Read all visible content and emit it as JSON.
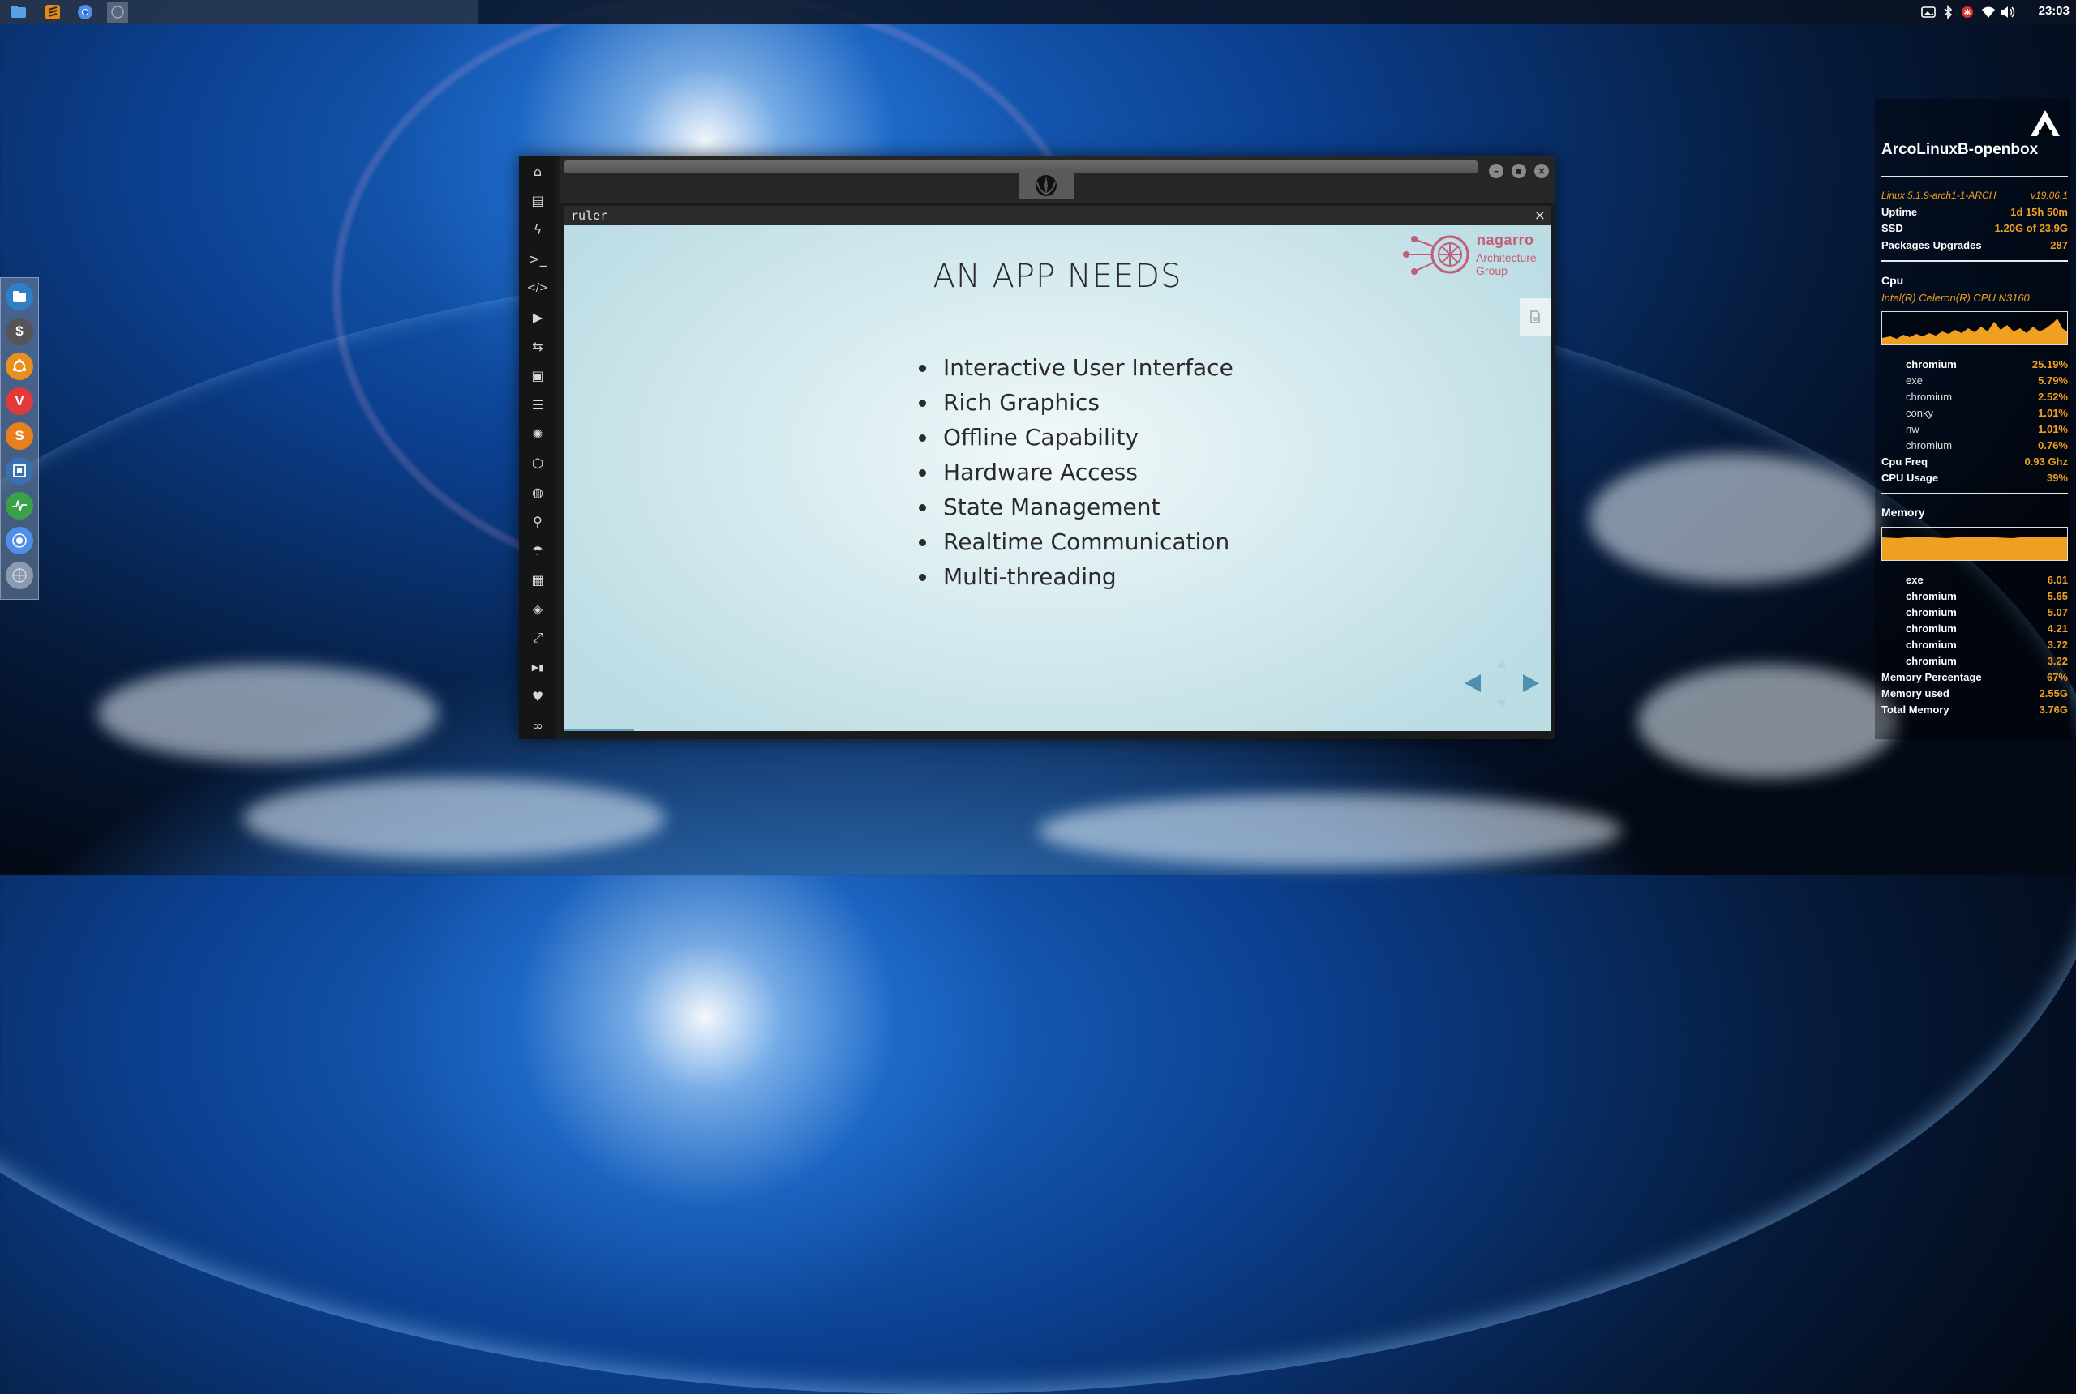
{
  "top_panel": {
    "clock": "23:03",
    "launchers": [
      "file-manager-icon",
      "sublime-text-icon",
      "chromium-icon",
      "workspace-icon"
    ],
    "tray": [
      "photo-icon",
      "bluetooth-icon",
      "network-alert-icon",
      "wifi-icon",
      "volume-icon"
    ]
  },
  "dock": {
    "items": [
      "files",
      "terminal",
      "ubuntu",
      "vivaldi",
      "sublime",
      "screenshot",
      "system-monitor",
      "chromium",
      "network"
    ]
  },
  "app": {
    "url_text": "ruler",
    "url_close": "×",
    "sidebar_icons": [
      "home",
      "document",
      "lightning",
      "terminal",
      "code",
      "play",
      "translate",
      "image",
      "news",
      "aperture",
      "hexagon",
      "globe",
      "search",
      "umbrella",
      "contact",
      "diamond-code",
      "expand",
      "youtube",
      "heart",
      "infinity"
    ]
  },
  "slide": {
    "title": "AN APP NEEDS",
    "bullets": [
      "Interactive User Interface",
      "Rich Graphics",
      "Offline Capability",
      "Hardware Access",
      "State Management",
      "Realtime Communication",
      "Multi-threading"
    ],
    "logo_name": "nagarro",
    "logo_line1": "Architecture",
    "logo_line2": "Group"
  },
  "conky": {
    "hostname": "ArcoLinuxB-openbox",
    "kernel": "Linux 5.1.9-arch1-1-ARCH",
    "version": "v19.06.1",
    "uptime_label": "Uptime",
    "uptime_value": "1d 15h 50m",
    "ssd_label": "SSD",
    "ssd_value": "1.20G of 23.9G",
    "packages_label": "Packages Upgrades",
    "packages_value": "287",
    "cpu_label": "Cpu",
    "cpu_name": "Intel(R) Celeron(R) CPU  N3160",
    "cpu_processes": [
      {
        "name": "chromium",
        "value": "25.19%"
      },
      {
        "name": "exe",
        "value": "5.79%"
      },
      {
        "name": "chromium",
        "value": "2.52%"
      },
      {
        "name": "conky",
        "value": "1.01%"
      },
      {
        "name": "nw",
        "value": "1.01%"
      },
      {
        "name": "chromium",
        "value": "0.76%"
      }
    ],
    "cpu_freq_label": "Cpu Freq",
    "cpu_freq_value": "0.93 Ghz",
    "cpu_usage_label": "CPU Usage",
    "cpu_usage_value": "39%",
    "memory_label": "Memory",
    "mem_processes": [
      {
        "name": "exe",
        "value": "6.01"
      },
      {
        "name": "chromium",
        "value": "5.65"
      },
      {
        "name": "chromium",
        "value": "5.07"
      },
      {
        "name": "chromium",
        "value": "4.21"
      },
      {
        "name": "chromium",
        "value": "3.72"
      },
      {
        "name": "chromium",
        "value": "3.22"
      }
    ],
    "mem_pct_label": "Memory Percentage",
    "mem_pct_value": "67%",
    "mem_used_label": "Memory used",
    "mem_used_value": "2.55G",
    "mem_total_label": "Total Memory",
    "mem_total_value": "3.76G",
    "accent": "#f0a020"
  }
}
